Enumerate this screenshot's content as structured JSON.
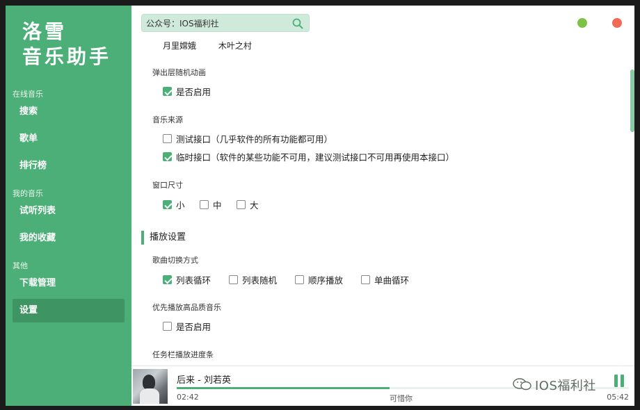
{
  "app": {
    "logo_line1": "洛雪",
    "logo_line2": "音乐助手"
  },
  "sidebar": {
    "groups": [
      {
        "title": "在线音乐",
        "items": [
          {
            "label": "搜索"
          },
          {
            "label": "歌单"
          },
          {
            "label": "排行榜"
          }
        ]
      },
      {
        "title": "我的音乐",
        "items": [
          {
            "label": "试听列表"
          },
          {
            "label": "我的收藏"
          }
        ]
      },
      {
        "title": "其他",
        "items": [
          {
            "label": "下载管理"
          },
          {
            "label": "设置",
            "active": true
          }
        ]
      }
    ]
  },
  "search": {
    "value": "公众号：IOS福利社",
    "icon": "search-icon"
  },
  "window_controls": {
    "minimize_color": "#7dc244",
    "close_color": "#f06a55"
  },
  "settings": {
    "tags": [
      "月里嫦娥",
      "木叶之村"
    ],
    "popup_anim": {
      "label": "弹出层随机动画",
      "enable": "是否启用",
      "checked": true
    },
    "music_source": {
      "label": "音乐来源",
      "options": [
        {
          "label": "测试接口（几乎软件的所有功能都可用）",
          "checked": false
        },
        {
          "label": "临时接口（软件的某些功能不可用，建议测试接口不可用再使用本接口）",
          "checked": true
        }
      ]
    },
    "window_size": {
      "label": "窗口尺寸",
      "options": [
        {
          "label": "小",
          "checked": true
        },
        {
          "label": "中",
          "checked": false
        },
        {
          "label": "大",
          "checked": false
        }
      ]
    },
    "play_section": "播放设置",
    "switch_mode": {
      "label": "歌曲切换方式",
      "options": [
        {
          "label": "列表循环",
          "checked": true
        },
        {
          "label": "列表随机",
          "checked": false
        },
        {
          "label": "顺序播放",
          "checked": false
        },
        {
          "label": "单曲循环",
          "checked": false
        }
      ]
    },
    "hq": {
      "label": "优先播放高品质音乐",
      "enable": "是否启用",
      "checked": false
    },
    "taskbar": {
      "label": "任务栏播放进度条"
    }
  },
  "player": {
    "title": "后来 - 刘若英",
    "current_time": "02:42",
    "lyric": "可惜你",
    "total_time": "05:42",
    "progress": 0.47,
    "watermark": "IOS福利社"
  },
  "accent_color": "#4caf78"
}
